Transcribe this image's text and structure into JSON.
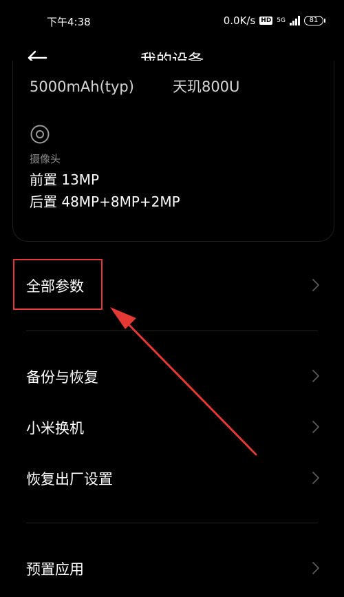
{
  "status_bar": {
    "time": "下午4:38",
    "net_speed": "0.0K/s",
    "hd": "HD",
    "network": "5G",
    "battery": "81"
  },
  "header": {
    "title": "我的设备",
    "back_icon": "arrow-left-icon"
  },
  "spec_card": {
    "cut_left": "5000mAh(typ)",
    "cut_right": "天玑800U",
    "camera_icon": "camera-icon",
    "camera_label": "摄像头",
    "front": "前置 13MP",
    "rear": "后置 48MP+8MP+2MP"
  },
  "menu": {
    "all_params": "全部参数",
    "backup_restore": "备份与恢复",
    "mi_mover": "小米换机",
    "factory_reset": "恢复出厂设置",
    "preinstalled_apps": "预置应用"
  },
  "annotation": {
    "color": "#e53935"
  }
}
